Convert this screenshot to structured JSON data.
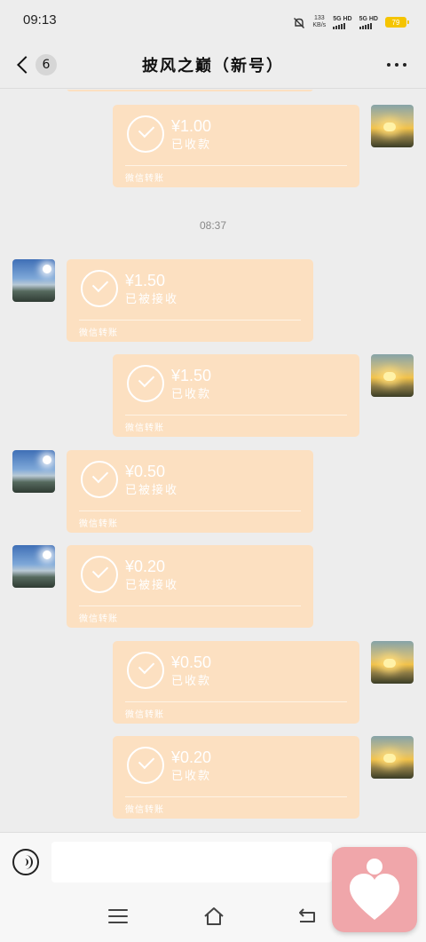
{
  "status_bar": {
    "time": "09:13",
    "net_speed": "133",
    "net_unit": "KB/s",
    "sim1_label": "5G HD",
    "sim2_label": "5G HD",
    "battery": "79"
  },
  "header": {
    "back_badge": "6",
    "title": "披风之巅（新号）"
  },
  "time_separator": "08:37",
  "messages": [
    {
      "side": "right",
      "amount": "¥1.00",
      "status": "已收款",
      "footer": "微信转账"
    },
    {
      "side": "left",
      "amount": "¥1.50",
      "status": "已被接收",
      "footer": "微信转账"
    },
    {
      "side": "right",
      "amount": "¥1.50",
      "status": "已收款",
      "footer": "微信转账"
    },
    {
      "side": "left",
      "amount": "¥0.50",
      "status": "已被接收",
      "footer": "微信转账"
    },
    {
      "side": "left",
      "amount": "¥0.20",
      "status": "已被接收",
      "footer": "微信转账"
    },
    {
      "side": "right",
      "amount": "¥0.50",
      "status": "已收款",
      "footer": "微信转账"
    },
    {
      "side": "right",
      "amount": "¥0.20",
      "status": "已收款",
      "footer": "微信转账"
    }
  ],
  "input": {
    "value": "",
    "placeholder": ""
  },
  "colors": {
    "transfer_card": "#fce0c1",
    "background": "#ededed",
    "float_app": "#f0a6aa"
  },
  "icons": {
    "voice": "voice-input-icon",
    "menu": "menu-icon",
    "home": "home-icon",
    "back": "back-icon",
    "more": "more-icon",
    "float_app": "heart-person-icon"
  }
}
